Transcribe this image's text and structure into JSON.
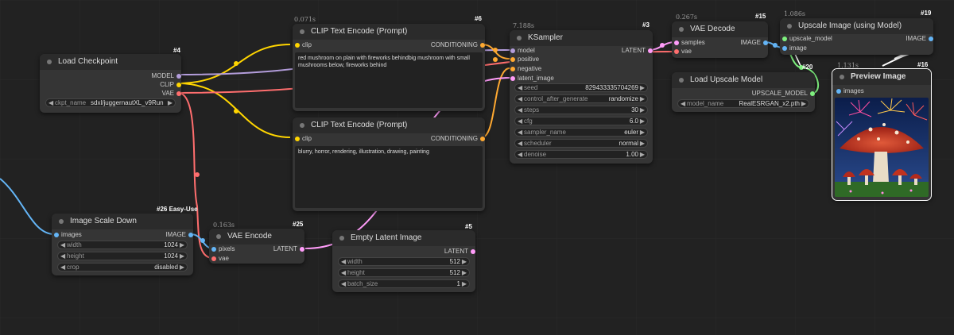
{
  "colors": {
    "clip": "#ffd500",
    "model": "#b39ddb",
    "vae": "#ff6e6e",
    "conditioning": "#ffa931",
    "latent": "#ff9cf9",
    "image": "#64b5f6",
    "upscale_model": "#7ef07e",
    "canvas": "#222222",
    "node": "#353535"
  },
  "nodes": {
    "load_checkpoint": {
      "title": "Load Checkpoint",
      "badge": "#4",
      "outputs": [
        "MODEL",
        "CLIP",
        "VAE"
      ],
      "widgets": [
        {
          "label": "ckpt_name",
          "value": "sdxl/juggernautXL_v9Rundiff..."
        }
      ]
    },
    "clip_pos": {
      "title": "CLIP Text Encode (Prompt)",
      "badge": "#6",
      "timing": "0.071s",
      "input": "clip",
      "output": "CONDITIONING",
      "text": "red mushroom on plain with fireworks behindbig mushroom with small mushrooms below, fireworks behind"
    },
    "clip_neg": {
      "title": "CLIP Text Encode (Prompt)",
      "input": "clip",
      "output": "CONDITIONING",
      "text": "blurry, horror, rendering, illustration, drawing, painting"
    },
    "ksampler": {
      "title": "KSampler",
      "badge": "#3",
      "timing": "7.188s",
      "inputs": [
        "model",
        "positive",
        "negative",
        "latent_image"
      ],
      "output": "LATENT",
      "widgets": [
        {
          "label": "seed",
          "value": "829433335704269"
        },
        {
          "label": "control_after_generate",
          "value": "randomize"
        },
        {
          "label": "steps",
          "value": "30"
        },
        {
          "label": "cfg",
          "value": "6.0"
        },
        {
          "label": "sampler_name",
          "value": "euler"
        },
        {
          "label": "scheduler",
          "value": "normal"
        },
        {
          "label": "denoise",
          "value": "1.00"
        }
      ]
    },
    "vae_decode": {
      "title": "VAE Decode",
      "badge": "#15",
      "timing": "0.267s",
      "inputs": [
        "samples",
        "vae"
      ],
      "output": "IMAGE"
    },
    "upscale_image": {
      "title": "Upscale Image (using Model)",
      "badge": "#19",
      "timing": "1.086s",
      "inputs": [
        "upscale_model",
        "image"
      ],
      "output": "IMAGE"
    },
    "load_upscale": {
      "title": "Load Upscale Model",
      "output": "UPSCALE_MODEL",
      "widgets": [
        {
          "label": "model_name",
          "value": "RealESRGAN_x2.pth"
        }
      ]
    },
    "preview": {
      "title": "Preview Image",
      "badge": "#16",
      "timing": "1.131s",
      "input": "images"
    },
    "reroute": {
      "badge": "#20"
    },
    "image_scale": {
      "title": "Image Scale Down",
      "badge": "#26 Easy-Use",
      "input": "images",
      "output": "IMAGE",
      "widgets": [
        {
          "label": "width",
          "value": "1024"
        },
        {
          "label": "height",
          "value": "1024"
        },
        {
          "label": "crop",
          "value": "disabled"
        }
      ]
    },
    "vae_encode": {
      "title": "VAE Encode",
      "badge": "#25",
      "timing": "0.163s",
      "inputs": [
        "pixels",
        "vae"
      ],
      "output": "LATENT"
    },
    "empty_latent": {
      "title": "Empty Latent Image",
      "badge": "#5",
      "output": "LATENT",
      "widgets": [
        {
          "label": "width",
          "value": "512"
        },
        {
          "label": "height",
          "value": "512"
        },
        {
          "label": "batch_size",
          "value": "1"
        }
      ]
    }
  }
}
